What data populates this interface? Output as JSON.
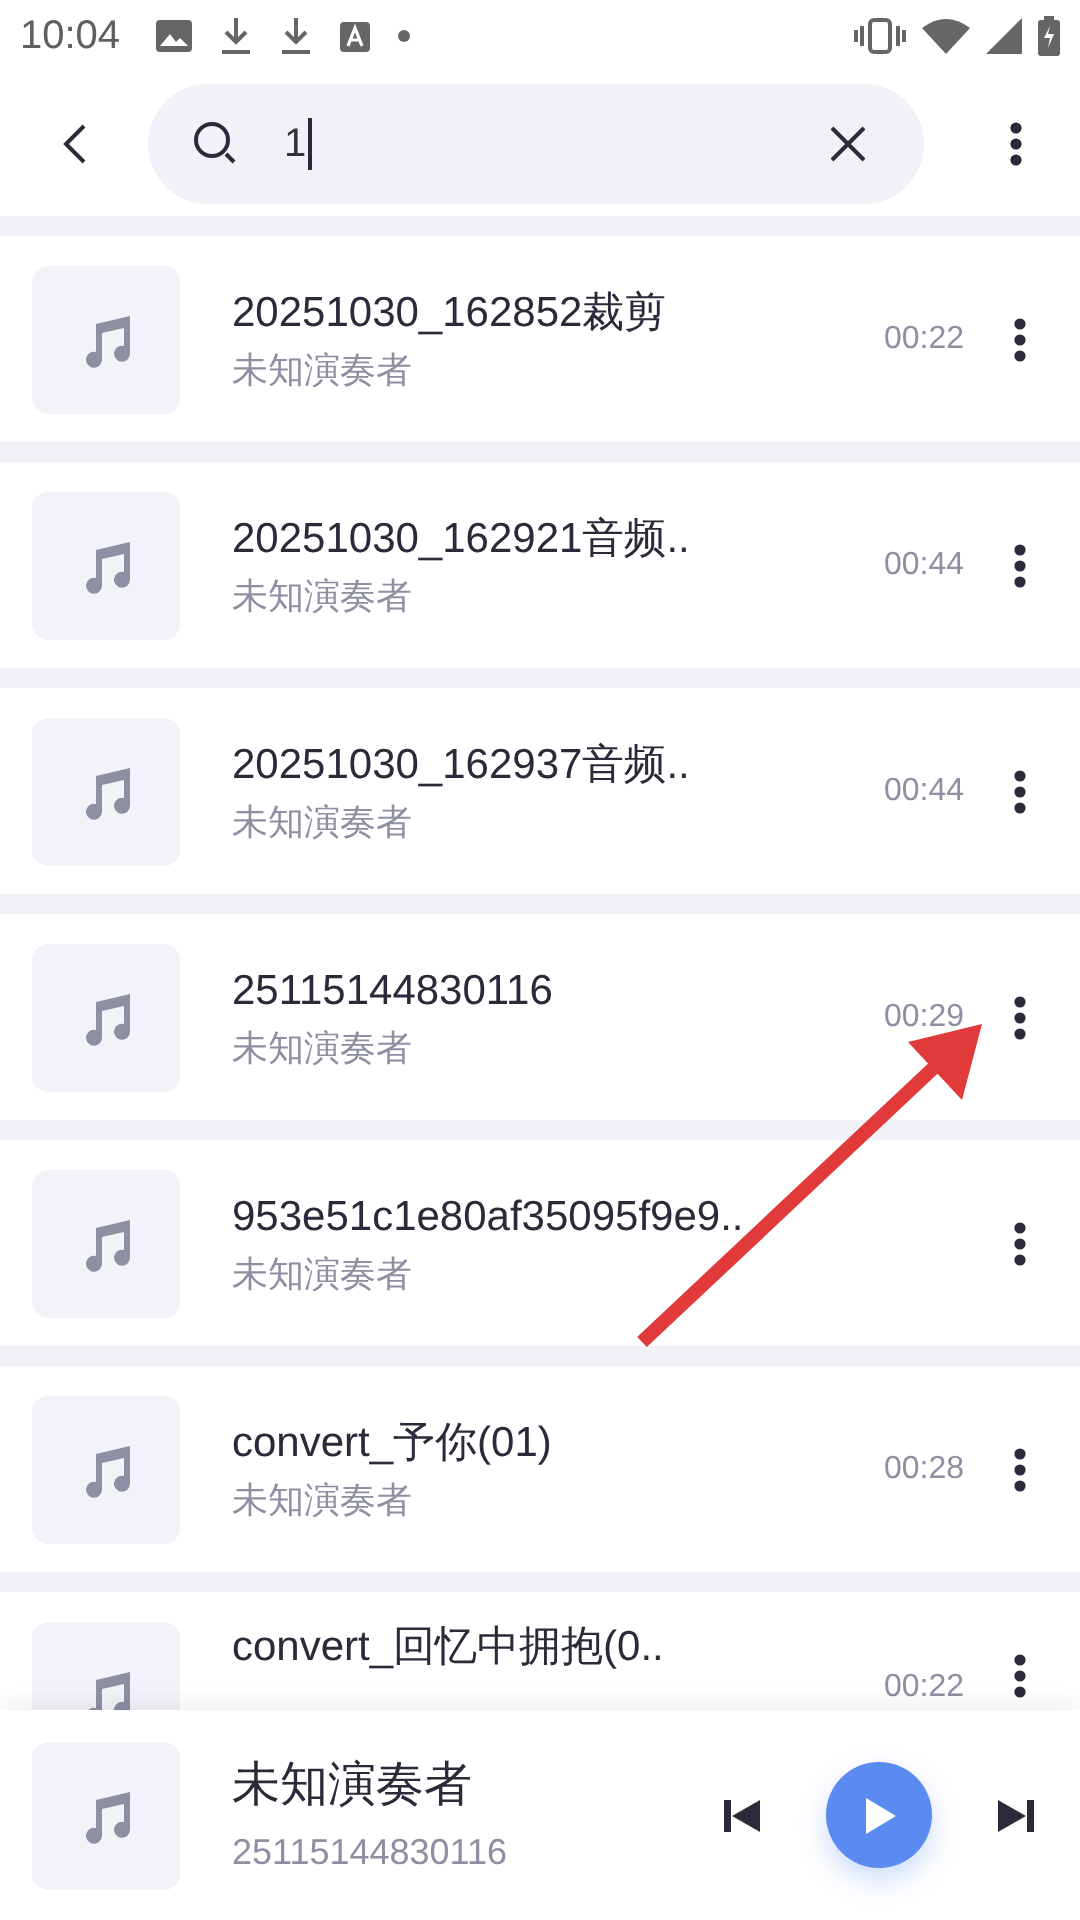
{
  "status_bar": {
    "time": "10:04"
  },
  "search": {
    "value": "1"
  },
  "songs": [
    {
      "title": "20251030_162852裁剪",
      "artist": "未知演奏者",
      "duration": "00:22"
    },
    {
      "title": "20251030_162921音频..",
      "artist": "未知演奏者",
      "duration": "00:44"
    },
    {
      "title": "20251030_162937音频..",
      "artist": "未知演奏者",
      "duration": "00:44"
    },
    {
      "title": "25115144830116",
      "artist": "未知演奏者",
      "duration": "00:29"
    },
    {
      "title": "953e51c1e80af35095f9e9..",
      "artist": "未知演奏者"
    },
    {
      "title": "convert_予你(01)",
      "artist": "未知演奏者",
      "duration": "00:28"
    },
    {
      "title": "convert_回忆中拥抱(0..",
      "duration": "00:22"
    }
  ],
  "player": {
    "title": "未知演奏者",
    "subtitle": "25115144830116"
  }
}
